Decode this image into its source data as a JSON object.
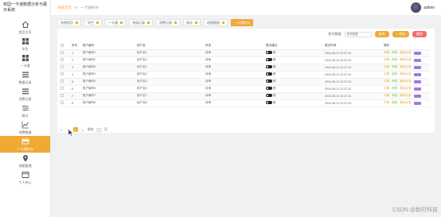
{
  "app": {
    "title": "校园一卡通数据分析与展示系统"
  },
  "sidebar": {
    "items": [
      {
        "label": "首页主页",
        "icon": "home-icon"
      },
      {
        "label": "学生",
        "icon": "grid-icon"
      },
      {
        "label": "一卡通",
        "icon": "grid-icon"
      },
      {
        "label": "数据记录",
        "icon": "list-icon"
      },
      {
        "label": "消费记录",
        "icon": "list-icon"
      },
      {
        "label": "统计",
        "icon": "sliders-icon"
      },
      {
        "label": "消费数据",
        "icon": "chart-icon"
      },
      {
        "label": "一卡通补办",
        "icon": "card-icon"
      },
      {
        "label": "地图管理",
        "icon": "pin-icon"
      },
      {
        "label": "个人中心",
        "icon": "window-icon"
      }
    ],
    "active_index": 7
  },
  "header": {
    "breadcrumb": [
      "系统首页",
      ">>",
      "一卡通补办"
    ],
    "username": "admin"
  },
  "tabs": [
    {
      "label": "系统首页"
    },
    {
      "label": "学生"
    },
    {
      "label": "一卡通"
    },
    {
      "label": "充值记录"
    },
    {
      "label": "消费记录"
    },
    {
      "label": "统计"
    },
    {
      "label": "地图管理"
    },
    {
      "label": "一卡通补办",
      "active": true
    }
  ],
  "toolbar": {
    "search_label": "账号数据",
    "search_placeholder": "账号数据",
    "search_button": "查询",
    "add_button": "+ 添加",
    "delete_button": "删除"
  },
  "table": {
    "headers": [
      "",
      "序号",
      "账户编号",
      "用户名",
      "状态",
      "是否通过",
      "提交时间",
      "操作"
    ],
    "rows": [
      {
        "index": "1",
        "account": "账户编号1",
        "user": "用户名1",
        "status": "待审",
        "pass": "是",
        "time": "2024-06-11 22:27:24"
      },
      {
        "index": "2",
        "account": "账户编号2",
        "user": "用户名2",
        "status": "待审",
        "pass": "是",
        "time": "2024-06-11 22:27:24"
      },
      {
        "index": "3",
        "account": "账户编号3",
        "user": "用户名3",
        "status": "待审",
        "pass": "是",
        "time": "2024-06-11 22:27:24"
      },
      {
        "index": "4",
        "account": "账户编号4",
        "user": "用户名4",
        "status": "待审",
        "pass": "是",
        "time": "2024-06-11 22:27:24"
      },
      {
        "index": "5",
        "account": "账户编号5",
        "user": "用户名5",
        "status": "待审",
        "pass": "是",
        "time": "2024-06-11 22:27:24"
      },
      {
        "index": "6",
        "account": "账户编号6",
        "user": "用户名6",
        "status": "待审",
        "pass": "是",
        "time": "2024-06-11 22:27:24"
      },
      {
        "index": "7",
        "account": "账户编号7",
        "user": "用户名7",
        "status": "待审",
        "pass": "是",
        "time": "2024-06-11 22:27:24"
      },
      {
        "index": "8",
        "account": "账户编号8",
        "user": "用户名8",
        "status": "待审",
        "pass": "是",
        "time": "2024-06-11 22:27:24"
      }
    ],
    "actions": {
      "view": "详情",
      "edit": "修改",
      "delete": "删除记录"
    }
  },
  "pager": {
    "prev": "<",
    "page_before": "1",
    "current": "1",
    "next": ">",
    "jump_label": "前往",
    "jump_value": "1",
    "jump_suffix": "页"
  },
  "watermark": "CSDN @新时科技",
  "colors": {
    "accent": "#f0a935",
    "danger": "#f56c6c",
    "success": "#67c23a",
    "purple": "#9b7de0"
  }
}
